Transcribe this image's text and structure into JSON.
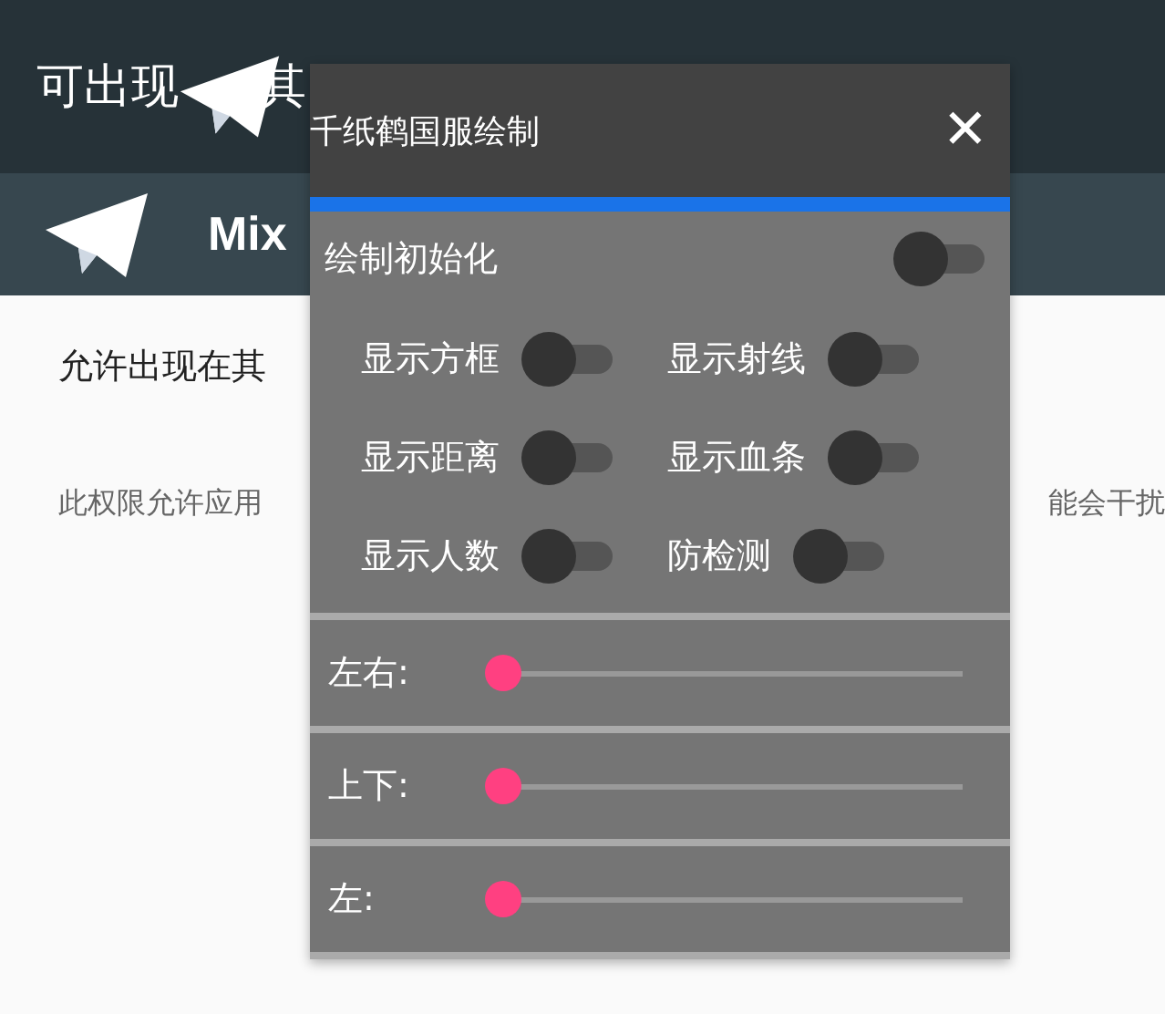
{
  "page": {
    "title": "可出现",
    "title_rest": "其",
    "app_name": "Mix",
    "toggle_label": "允许出现在其",
    "description_left": "此权限允许应用",
    "description_right": "能会干扰"
  },
  "panel": {
    "title": "千纸鹤国服绘制",
    "close": "✕",
    "main_switch": {
      "label": "绘制初始化",
      "on": false
    },
    "switches": [
      {
        "label": "显示方框",
        "on": false
      },
      {
        "label": "显示射线",
        "on": false
      },
      {
        "label": "显示距离",
        "on": false
      },
      {
        "label": "显示血条",
        "on": false
      },
      {
        "label": "显示人数",
        "on": false
      },
      {
        "label": "防检测",
        "on": false
      }
    ],
    "sliders": [
      {
        "label": "左右:",
        "level": 0
      },
      {
        "label": "上下:",
        "level": 0
      },
      {
        "label": "左:",
        "level": 0
      }
    ]
  }
}
